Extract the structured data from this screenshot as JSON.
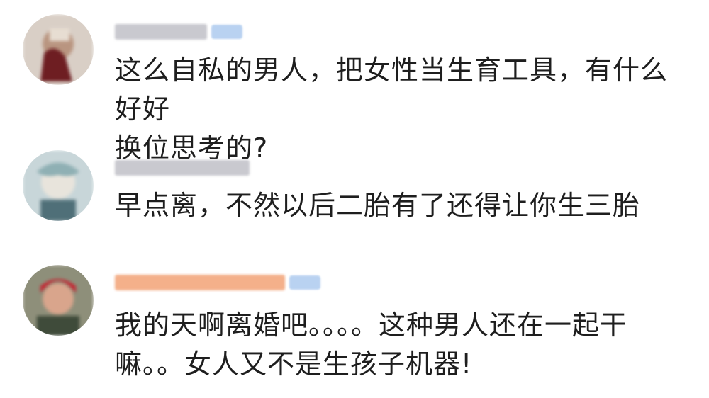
{
  "colors": {
    "background": "#ffffff",
    "text": "#1e1e1e",
    "name_blur_gray": "#c9c9cf",
    "name_blur_orange": "#f4b08a",
    "badge_blue": "#b9d2f1"
  },
  "comments": [
    {
      "line1": "这么自私的男人，把女性当生育工具，有什么好好",
      "line2": "换位思考的?",
      "has_badge": true,
      "avatar": "avatar-icon"
    },
    {
      "line1": "早点离，不然以后二胎有了还得让你生三胎",
      "has_badge": false,
      "avatar": "avatar-icon"
    },
    {
      "line1": "我的天啊离婚吧。。。。这种男人还在一起干",
      "line2": "嘛。。女人又不是生孩子机器!",
      "has_badge": true,
      "avatar": "avatar-icon"
    }
  ]
}
